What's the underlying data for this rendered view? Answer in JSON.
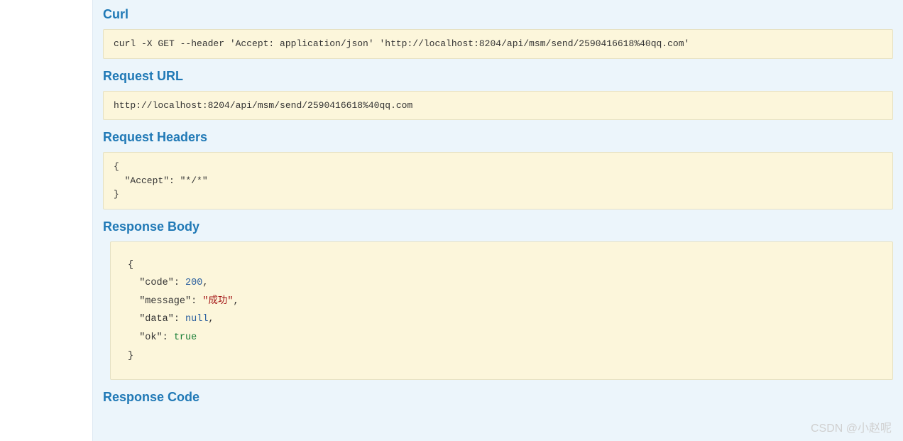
{
  "sections": {
    "curl": {
      "title": "Curl",
      "content": "curl -X GET --header 'Accept: application/json' 'http://localhost:8204/api/msm/send/2590416618%40qq.com'"
    },
    "request_url": {
      "title": "Request URL",
      "content": "http://localhost:8204/api/msm/send/2590416618%40qq.com"
    },
    "request_headers": {
      "title": "Request Headers",
      "content": "{\n  \"Accept\": \"*/*\"\n}"
    },
    "response_body": {
      "title": "Response Body",
      "json": {
        "code": 200,
        "message": "成功",
        "data": null,
        "ok": true
      }
    },
    "response_code": {
      "title": "Response Code"
    }
  },
  "watermark": "CSDN @小赵呢"
}
